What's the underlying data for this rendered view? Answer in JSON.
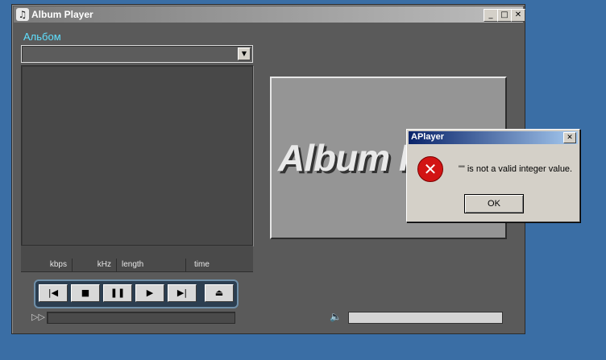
{
  "window": {
    "title": "Album Player",
    "app_icon": "music-note-icon",
    "buttons": {
      "minimize": "_",
      "maximize": "□",
      "close": "✕"
    }
  },
  "album": {
    "label": "Альбом",
    "selected_value": ""
  },
  "info_columns": [
    "kbps",
    "kHz",
    "length",
    "time"
  ],
  "controls": [
    {
      "name": "previous-button",
      "icon": "skip-back-icon",
      "glyph": "|◀"
    },
    {
      "name": "stop-button",
      "icon": "stop-icon",
      "glyph": "■"
    },
    {
      "name": "pause-button",
      "icon": "pause-icon",
      "glyph": "❚❚"
    },
    {
      "name": "play-button",
      "icon": "play-icon",
      "glyph": "▶"
    },
    {
      "name": "next-button",
      "icon": "skip-forward-icon",
      "glyph": "▶|"
    },
    {
      "name": "eject-button",
      "icon": "eject-icon",
      "glyph": "⏏"
    }
  ],
  "position": {
    "icon": "fast-forward-icon",
    "glyph": "▷▷",
    "progress": 0
  },
  "volume": {
    "icon": "speaker-icon",
    "glyph": "🔈",
    "level": 0
  },
  "logo": {
    "text": "Album Player"
  },
  "dialog": {
    "title": "APlayer",
    "close": "✕",
    "icon": "error-icon",
    "icon_glyph": "✕",
    "message": "\"\" is not a valid integer value.",
    "ok_label": "OK"
  },
  "colors": {
    "desktop": "#3a6ea5",
    "window_bg": "#5a5a5a",
    "album_label": "#5fe0ff",
    "dialog_title": "#0a246a",
    "error_red": "#d21414"
  }
}
